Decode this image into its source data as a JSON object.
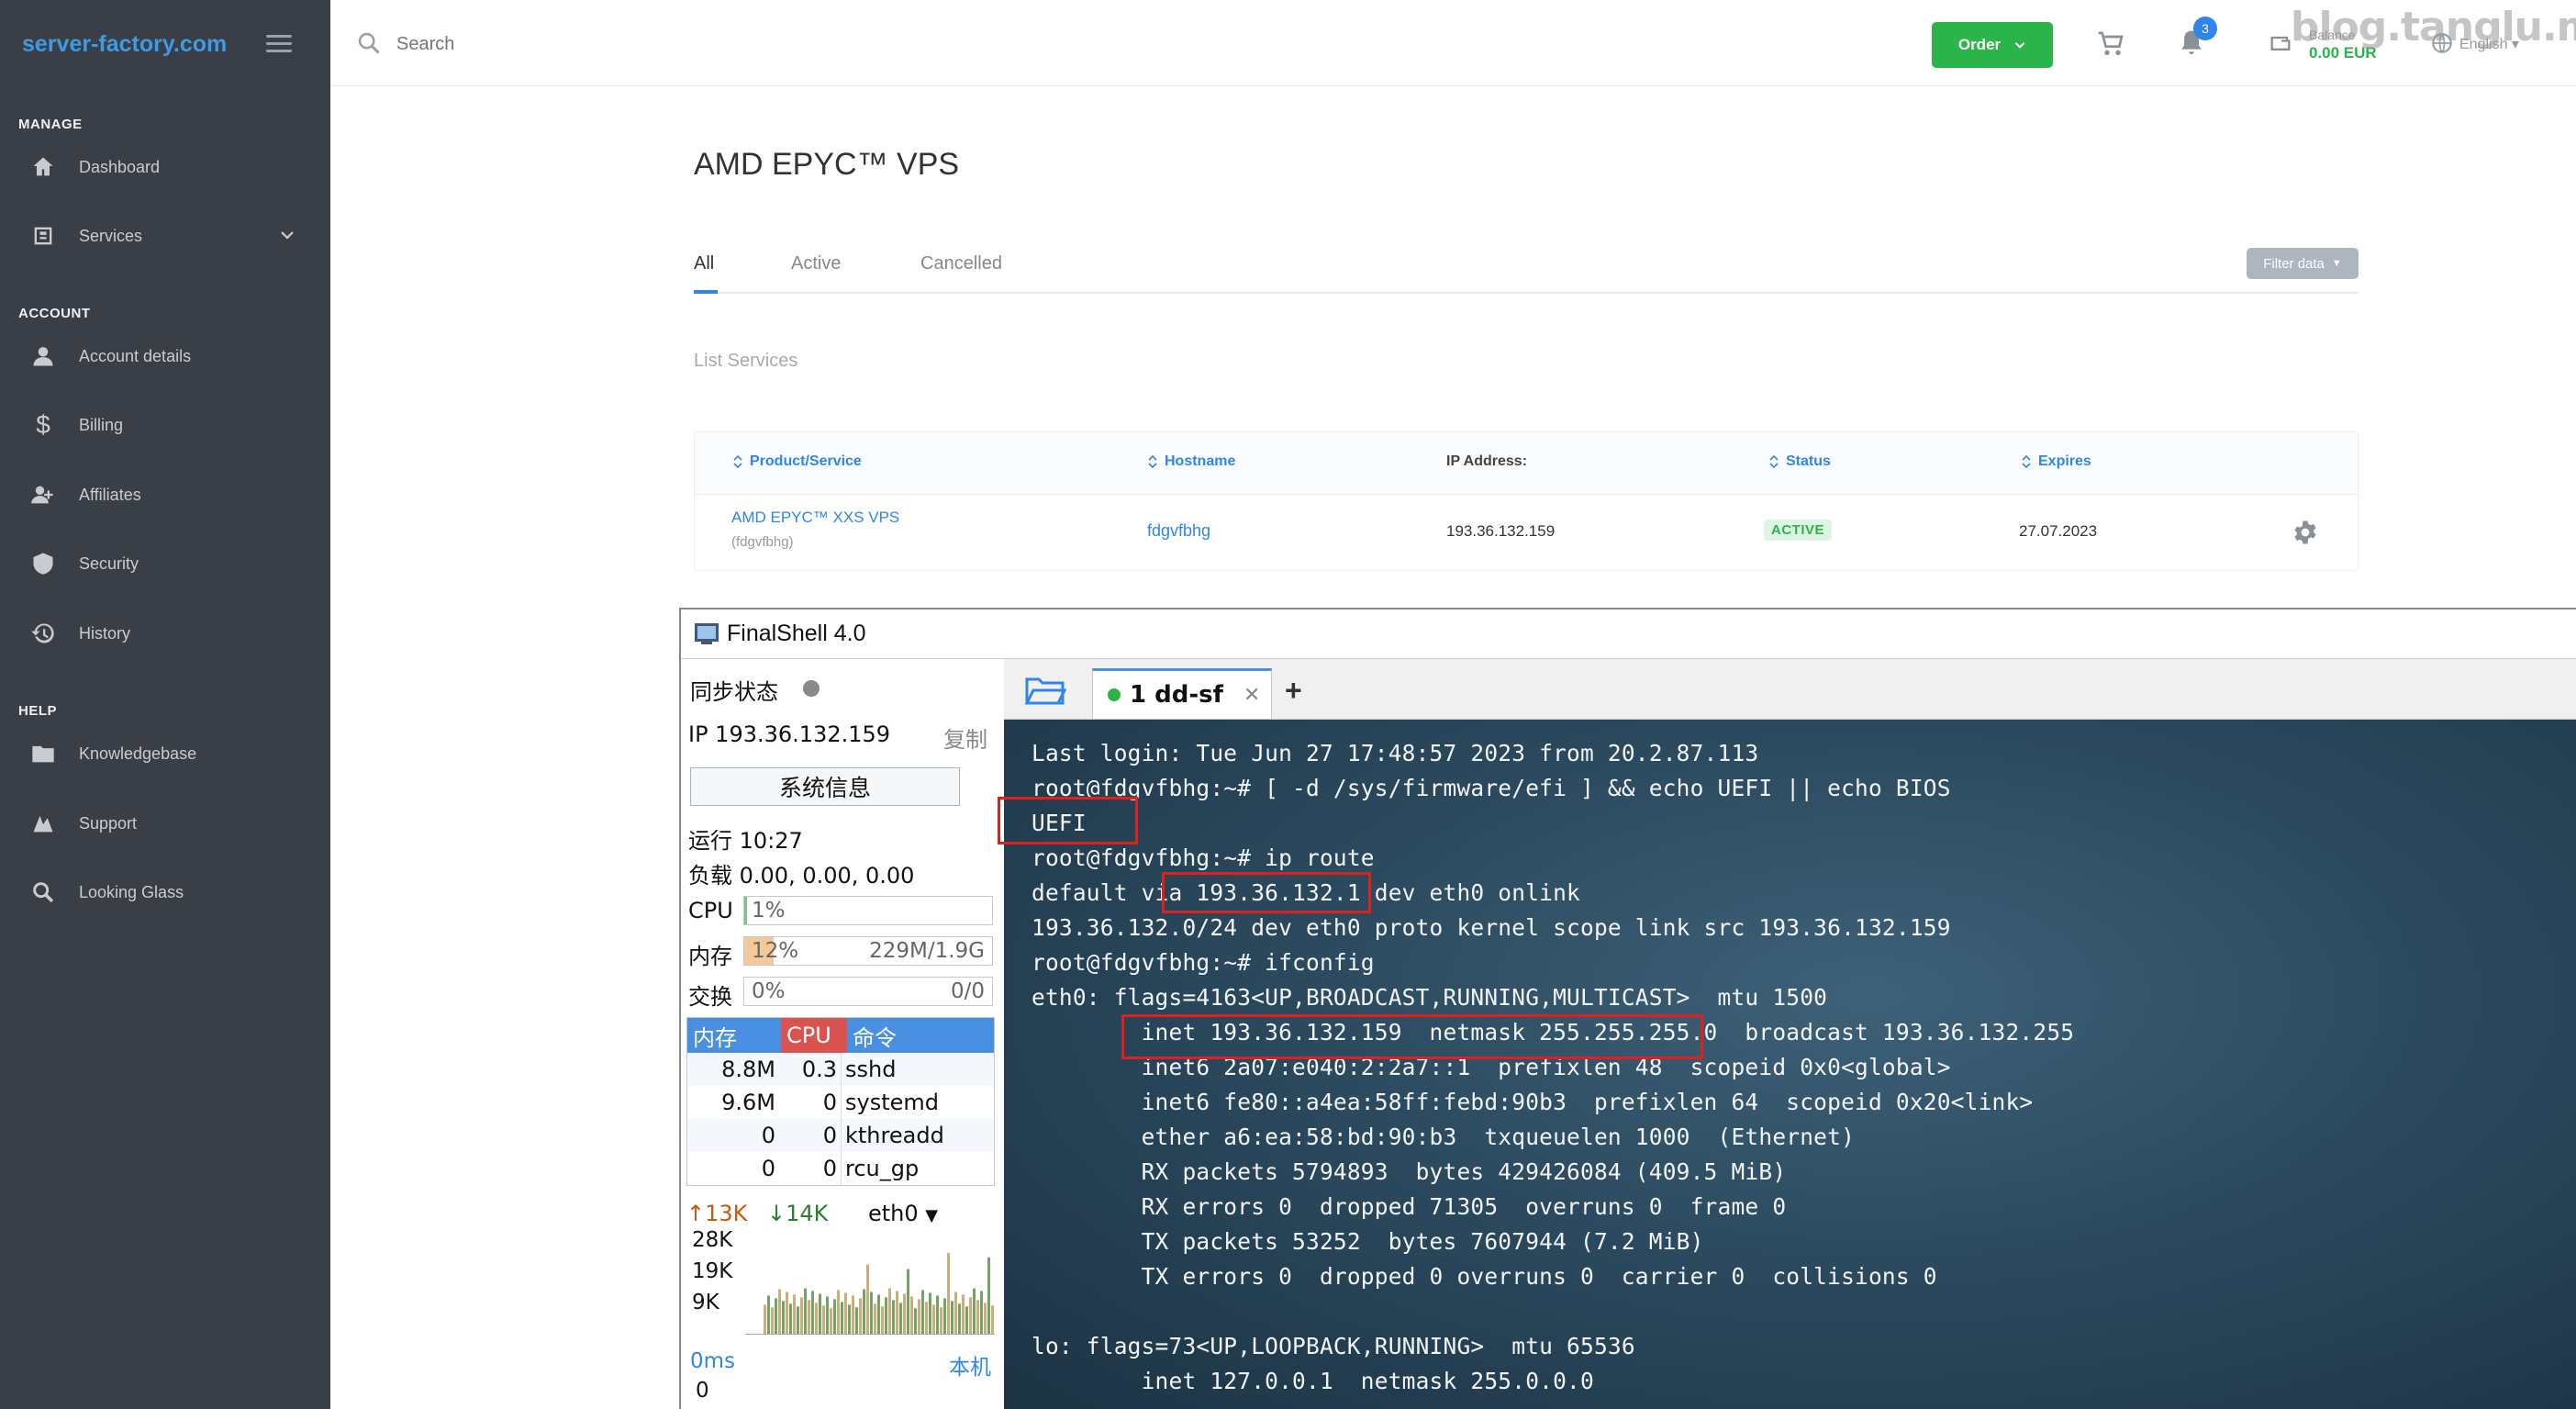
{
  "sidebar": {
    "brand": "server-factory.com",
    "sections": {
      "manage": "MANAGE",
      "account": "ACCOUNT",
      "help": "HELP"
    },
    "items": [
      {
        "label": "Dashboard",
        "icon": "home-icon"
      },
      {
        "label": "Services",
        "icon": "services-icon"
      },
      {
        "label": "Account details",
        "icon": "user-icon"
      },
      {
        "label": "Billing",
        "icon": "dollar-icon"
      },
      {
        "label": "Affiliates",
        "icon": "affiliates-icon"
      },
      {
        "label": "Security",
        "icon": "shield-icon"
      },
      {
        "label": "History",
        "icon": "history-icon"
      },
      {
        "label": "Knowledgebase",
        "icon": "folder-icon"
      },
      {
        "label": "Support",
        "icon": "support-icon"
      },
      {
        "label": "Looking Glass",
        "icon": "search-icon"
      }
    ]
  },
  "topbar": {
    "search_placeholder": "Search",
    "order_label": "Order",
    "notification_count": "3",
    "credit_label": "Balance",
    "credit_value": "0.00 EUR",
    "language": "English",
    "watermark": "blog.tanglu.me"
  },
  "main": {
    "title": "AMD EPYC™ VPS",
    "tabs": [
      "All",
      "Active",
      "Cancelled"
    ],
    "filter_label": "Filter data",
    "list_label": "List Services",
    "columns": [
      "Product/Service",
      "Hostname",
      "IP Address:",
      "Status",
      "Expires"
    ],
    "row": {
      "product": "AMD EPYC™ XXS VPS",
      "product_sub": "(fdgvfbhg)",
      "hostname": "fdgvfbhg",
      "ip": "193.36.132.159",
      "status": "ACTIVE",
      "expires": "27.07.2023"
    }
  },
  "finalshell": {
    "title": "FinalShell 4.0",
    "sync_label": "同步状态",
    "ip_label": "IP  193.36.132.159",
    "copy_label": "复制",
    "sysinfo_label": "系统信息",
    "uptime": "运行 10:27",
    "load": "负载 0.00, 0.00, 0.00",
    "cpu_label": "CPU",
    "cpu_value": "1%",
    "cpu_pct": 1,
    "mem_label": "内存",
    "mem_value": "12%",
    "mem_pct": 12,
    "mem_total": "229M/1.9G",
    "swap_label": "交换",
    "swap_value": "0%",
    "swap_total": "0/0",
    "proc_headers": [
      "内存",
      "CPU",
      "命令"
    ],
    "processes": [
      {
        "mem": "8.8M",
        "cpu": "0.3",
        "cmd": "sshd"
      },
      {
        "mem": "9.6M",
        "cpu": "0",
        "cmd": "systemd"
      },
      {
        "mem": "0",
        "cpu": "0",
        "cmd": "kthreadd"
      },
      {
        "mem": "0",
        "cpu": "0",
        "cmd": "rcu_gp"
      }
    ],
    "net_up": "↑13K",
    "net_down": "↓14K",
    "net_if": "eth0",
    "net_scale": [
      "28K",
      "19K",
      "9K"
    ],
    "ping": "0ms",
    "ping_host": "本机",
    "ping_value": "0",
    "tab_label": "1 dd-sf",
    "terminal_lines": [
      "Last login: Tue Jun 27 17:48:57 2023 from 20.2.87.113",
      "root@fdgvfbhg:~# [ -d /sys/firmware/efi ] && echo UEFI || echo BIOS",
      "UEFI",
      "root@fdgvfbhg:~# ip route",
      "default via 193.36.132.1 dev eth0 onlink",
      "193.36.132.0/24 dev eth0 proto kernel scope link src 193.36.132.159",
      "root@fdgvfbhg:~# ifconfig",
      "eth0: flags=4163<UP,BROADCAST,RUNNING,MULTICAST>  mtu 1500",
      "        inet 193.36.132.159  netmask 255.255.255.0  broadcast 193.36.132.255",
      "        inet6 2a07:e040:2:2a7::1  prefixlen 48  scopeid 0x0<global>",
      "        inet6 fe80::a4ea:58ff:febd:90b3  prefixlen 64  scopeid 0x20<link>",
      "        ether a6:ea:58:bd:90:b3  txqueuelen 1000  (Ethernet)",
      "        RX packets 5794893  bytes 429426084 (409.5 MiB)",
      "        RX errors 0  dropped 71305  overruns 0  frame 0",
      "        TX packets 53252  bytes 7607944 (7.2 MiB)",
      "        TX errors 0  dropped 0 overruns 0  carrier 0  collisions 0",
      "",
      "lo: flags=73<UP,LOOPBACK,RUNNING>  mtu 65536",
      "        inet 127.0.0.1  netmask 255.0.0.0"
    ]
  }
}
